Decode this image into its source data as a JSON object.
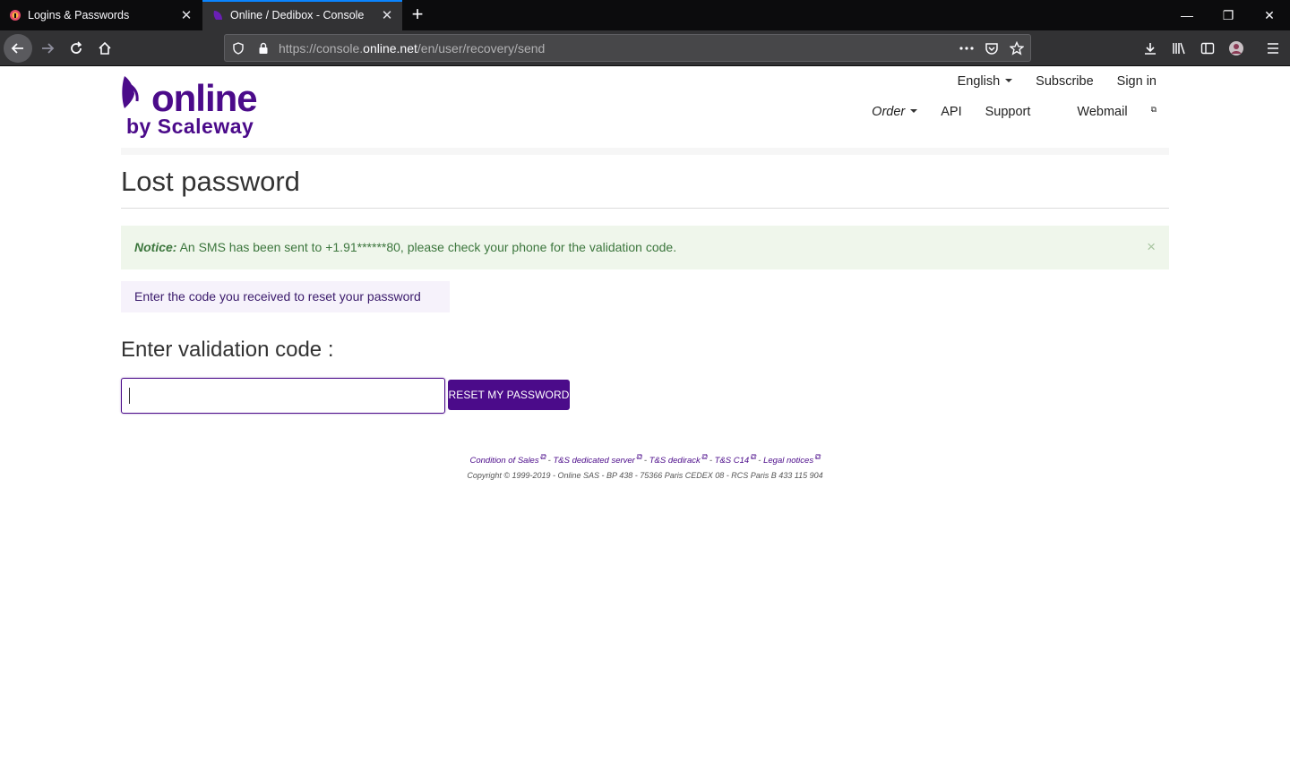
{
  "browser": {
    "tabs": [
      {
        "title": "Logins & Passwords"
      },
      {
        "title": "Online / Dedibox - Console"
      }
    ],
    "url": {
      "prefix": "https://console.",
      "host": "online.net",
      "path": "/en/user/recovery/send"
    },
    "window_controls": {
      "minimize": "—",
      "restore": "❐",
      "close": "✕"
    }
  },
  "site": {
    "logo": {
      "word": "online",
      "sub": "by Scaleway",
      "color": "#4b0b8a"
    },
    "topnav": {
      "language": "English",
      "subscribe": "Subscribe",
      "signin": "Sign in"
    },
    "subnav": {
      "order": "Order",
      "api": "API",
      "support": "Support",
      "webmail": "Webmail"
    }
  },
  "main": {
    "title": "Lost password",
    "notice": {
      "label": "Notice:",
      "message": " An SMS has been sent to +1.91******80, please check your phone for the validation code.",
      "close": "×"
    },
    "info": "Enter the code you received to reset your password",
    "code_heading": "Enter validation code :",
    "code_value": "",
    "reset_button": "RESET MY PASSWORD"
  },
  "footer": {
    "links": [
      "Condition of Sales",
      "T&S dedicated server",
      "T&S dedirack",
      "T&S C14",
      "Legal notices"
    ],
    "separator": " - ",
    "copyright": "Copyright © 1999-2019 - Online SAS - BP 438 - 75366 Paris CEDEX 08 - RCS Paris B 433 115 904"
  },
  "colors": {
    "brand": "#4b0b8a",
    "notice_bg": "#eff6eb",
    "notice_text": "#3c763d"
  }
}
